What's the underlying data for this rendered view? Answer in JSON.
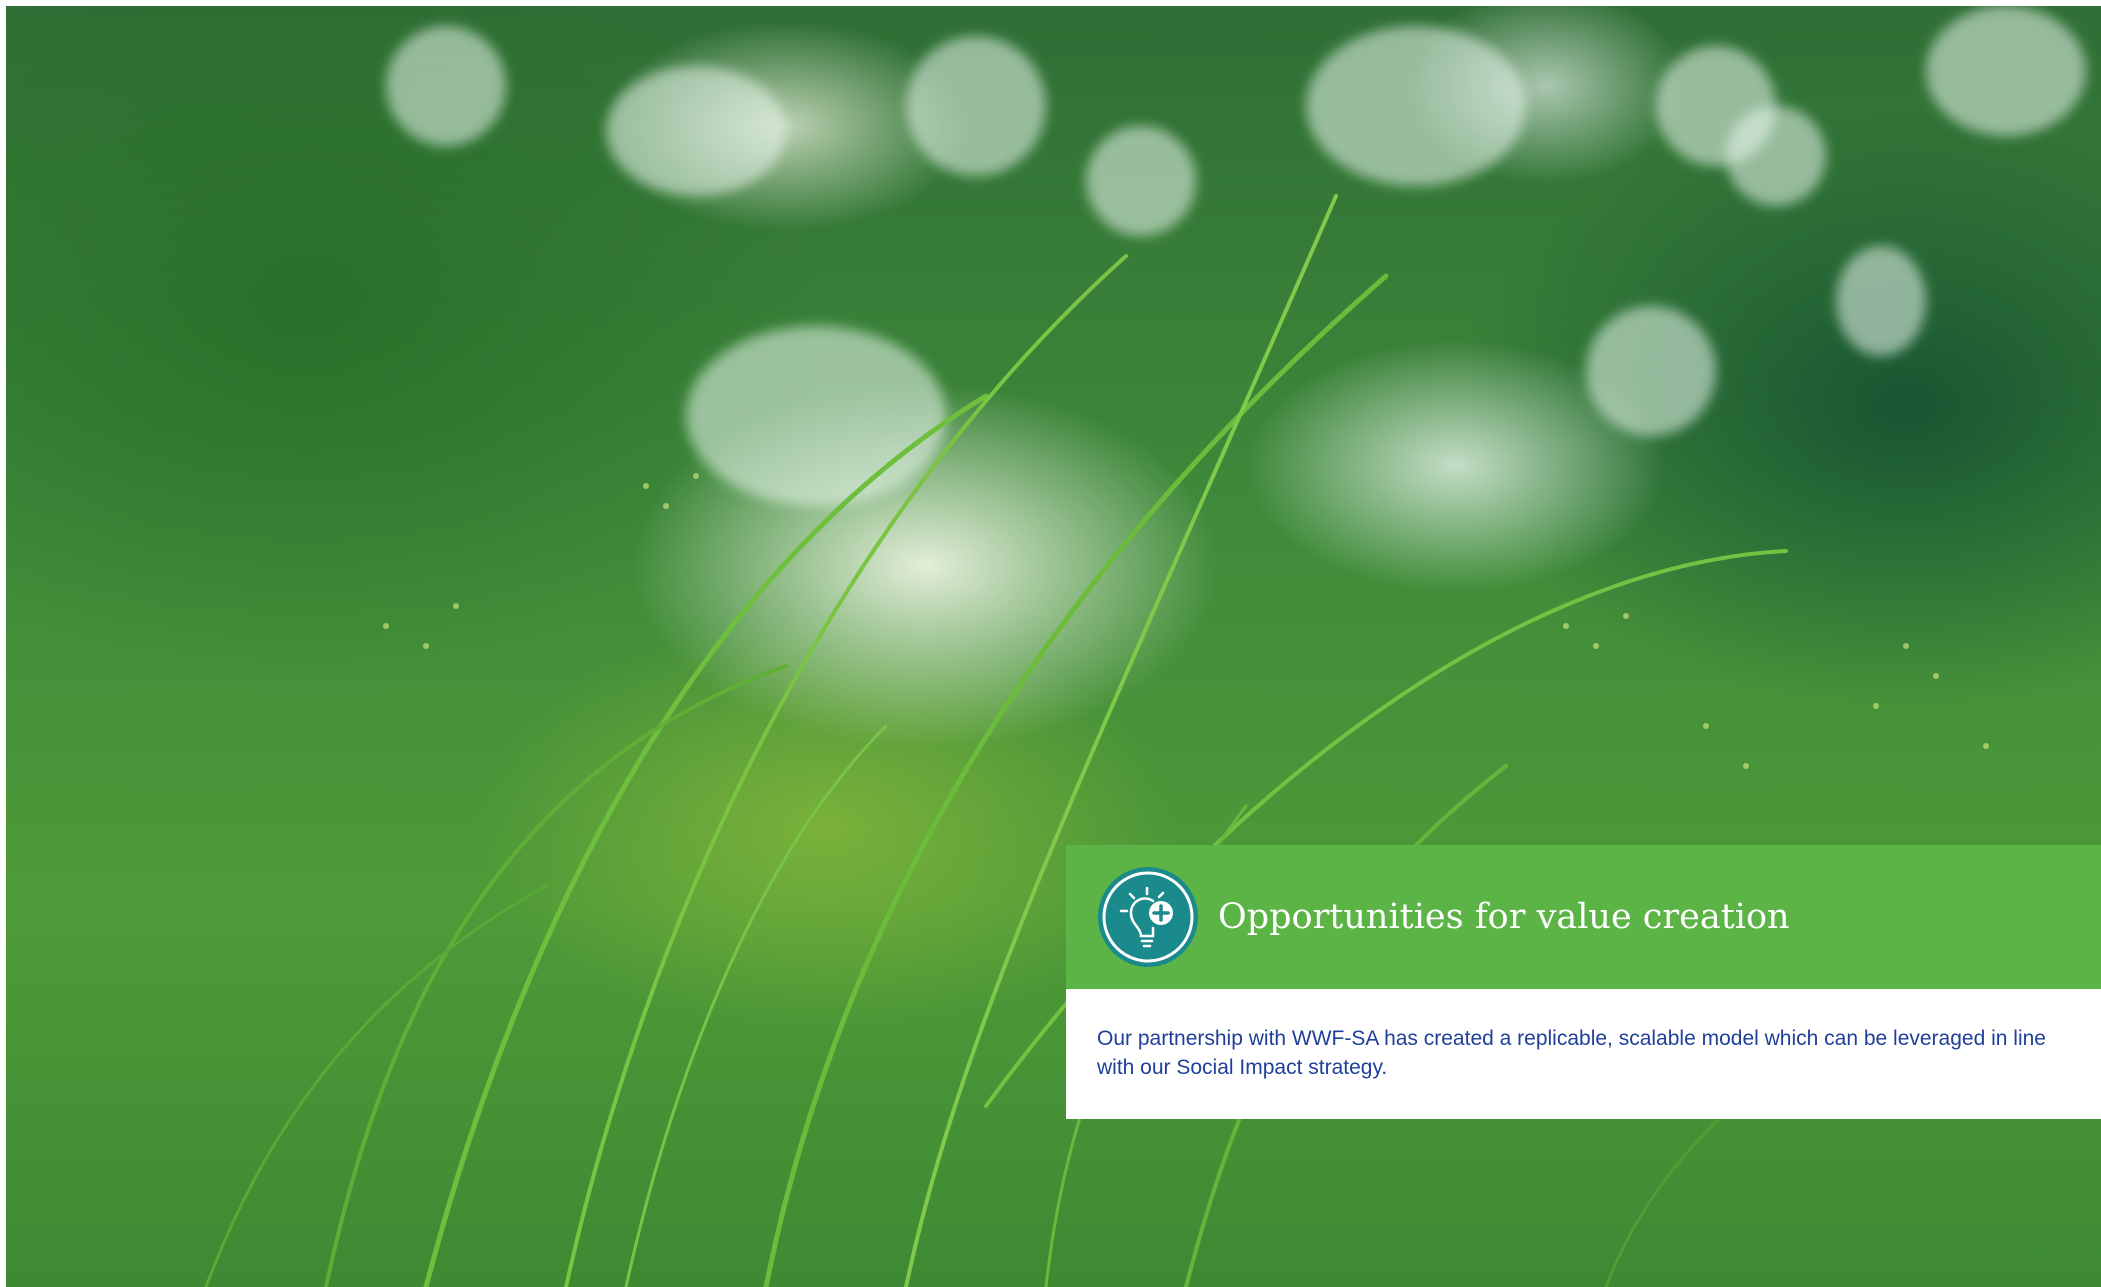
{
  "callout": {
    "title": "Opportunities for value creation",
    "body": "Our partnership with WWF-SA has created a replicable, scalable model which can be leveraged in line with our Social Impact strategy.",
    "icon": "lightbulb-plus-icon"
  },
  "colors": {
    "title_band": "#5cb346",
    "badge_fill": "#1a8a8c",
    "body_text": "#1f3f9a",
    "title_text": "#ffffff"
  },
  "background": {
    "subject": "grass-photo"
  }
}
